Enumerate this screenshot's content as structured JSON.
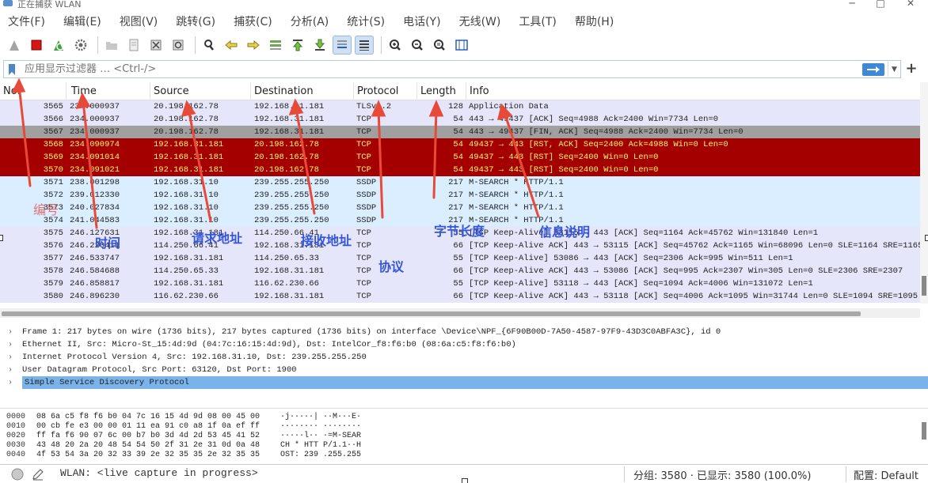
{
  "titlebar": {
    "title": "正在捕获 WLAN",
    "min": "─",
    "max": "□",
    "close": "✕"
  },
  "menu": [
    "文件(F)",
    "编辑(E)",
    "视图(V)",
    "跳转(G)",
    "捕获(C)",
    "分析(A)",
    "统计(S)",
    "电话(Y)",
    "无线(W)",
    "工具(T)",
    "帮助(H)"
  ],
  "filter": {
    "placeholder": "应用显示过滤器 … <Ctrl-/>",
    "apply_icon": "arrow-right-icon",
    "plus": "+"
  },
  "toolbar_icons": [
    "shark-fin-icon",
    "stop-icon",
    "restart-icon",
    "options-gear-icon",
    "open-folder-icon",
    "save-file-icon",
    "close-file-icon",
    "reload-icon",
    "search-icon",
    "back-icon",
    "forward-icon",
    "goto-icon",
    "first-icon",
    "last-icon",
    "autoscroll-icon",
    "colorize-icon",
    "zoom-in-icon",
    "zoom-out-icon",
    "zoom-normal-icon",
    "resize-columns-icon"
  ],
  "columns": [
    "No.",
    "Time",
    "Source",
    "Destination",
    "Protocol",
    "Length",
    "Info"
  ],
  "packets": [
    {
      "no": "3565",
      "time": "234.000937",
      "src": "20.198.162.78",
      "dst": "192.168.31.181",
      "proto": "TLSv1.2",
      "len": "128",
      "info": "Application Data",
      "style": "row-tls"
    },
    {
      "no": "3566",
      "time": "234.000937",
      "src": "20.198.162.78",
      "dst": "192.168.31.181",
      "proto": "TCP",
      "len": "54",
      "info": "443 → 49437 [ACK] Seq=4988 Ack=2400 Win=7734 Len=0",
      "style": "row-tcp"
    },
    {
      "no": "3567",
      "time": "234.000937",
      "src": "20.198.162.78",
      "dst": "192.168.31.181",
      "proto": "TCP",
      "len": "54",
      "info": "443 → 49437 [FIN, ACK] Seq=4988 Ack=2400 Win=7734 Len=0",
      "style": "row-fin"
    },
    {
      "no": "3568",
      "time": "234.090974",
      "src": "192.168.31.181",
      "dst": "20.198.162.78",
      "proto": "TCP",
      "len": "54",
      "info": "49437 → 443 [RST, ACK] Seq=2400 Ack=4988 Win=0 Len=0",
      "style": "row-rst"
    },
    {
      "no": "3569",
      "time": "234.091014",
      "src": "192.168.31.181",
      "dst": "20.198.162.78",
      "proto": "TCP",
      "len": "54",
      "info": "49437 → 443 [RST] Seq=2400 Win=0 Len=0",
      "style": "row-rst"
    },
    {
      "no": "3570",
      "time": "234.091021",
      "src": "192.168.31.181",
      "dst": "20.198.162.78",
      "proto": "TCP",
      "len": "54",
      "info": "49437 → 443 [RST] Seq=2400 Win=0 Len=0",
      "style": "row-rst"
    },
    {
      "no": "3571",
      "time": "238.001298",
      "src": "192.168.31.10",
      "dst": "239.255.255.250",
      "proto": "SSDP",
      "len": "217",
      "info": "M-SEARCH * HTTP/1.1",
      "style": "row-ssdp"
    },
    {
      "no": "3572",
      "time": "239.012330",
      "src": "192.168.31.10",
      "dst": "239.255.255.250",
      "proto": "SSDP",
      "len": "217",
      "info": "M-SEARCH * HTTP/1.1",
      "style": "row-ssdp"
    },
    {
      "no": "3573",
      "time": "240.027834",
      "src": "192.168.31.10",
      "dst": "239.255.255.250",
      "proto": "SSDP",
      "len": "217",
      "info": "M-SEARCH * HTTP/1.1",
      "style": "row-ssdp"
    },
    {
      "no": "3574",
      "time": "241.044583",
      "src": "192.168.31.10",
      "dst": "239.255.255.250",
      "proto": "SSDP",
      "len": "217",
      "info": "M-SEARCH * HTTP/1.1",
      "style": "row-ssdp"
    },
    {
      "no": "3575",
      "time": "246.127631",
      "src": "192.168.31.181",
      "dst": "114.250.66.41",
      "proto": "TCP",
      "len": "55",
      "info": "[TCP Keep-Alive] 53115 → 443 [ACK] Seq=1164 Ack=45762 Win=131840 Len=1",
      "style": "row-ka"
    },
    {
      "no": "3576",
      "time": "246.220411",
      "src": "114.250.66.41",
      "dst": "192.168.31.181",
      "proto": "TCP",
      "len": "66",
      "info": "[TCP Keep-Alive ACK] 443 → 53115 [ACK] Seq=45762 Ack=1165 Win=68096 Len=0 SLE=1164 SRE=1165",
      "style": "row-ka"
    },
    {
      "no": "3577",
      "time": "246.533747",
      "src": "192.168.31.181",
      "dst": "114.250.65.33",
      "proto": "TCP",
      "len": "55",
      "info": "[TCP Keep-Alive] 53086 → 443 [ACK] Seq=2306 Ack=995 Win=511 Len=1",
      "style": "row-ka"
    },
    {
      "no": "3578",
      "time": "246.584688",
      "src": "114.250.65.33",
      "dst": "192.168.31.181",
      "proto": "TCP",
      "len": "66",
      "info": "[TCP Keep-Alive ACK] 443 → 53086 [ACK] Seq=995 Ack=2307 Win=305 Len=0 SLE=2306 SRE=2307",
      "style": "row-ka"
    },
    {
      "no": "3579",
      "time": "246.858817",
      "src": "192.168.31.181",
      "dst": "116.62.230.66",
      "proto": "TCP",
      "len": "55",
      "info": "[TCP Keep-Alive] 53118 → 443 [ACK] Seq=1094 Ack=4006 Win=131072 Len=1",
      "style": "row-ka"
    },
    {
      "no": "3580",
      "time": "246.896230",
      "src": "116.62.230.66",
      "dst": "192.168.31.181",
      "proto": "TCP",
      "len": "66",
      "info": "[TCP Keep-Alive ACK] 443 → 53118 [ACK] Seq=4006 Ack=1095 Win=31744 Len=0 SLE=1094 SRE=1095",
      "style": "row-ka"
    }
  ],
  "details": [
    "Frame 1: 217 bytes on wire (1736 bits), 217 bytes captured (1736 bits) on interface \\Device\\NPF_{6F90B00D-7A50-4587-97F9-43D3C0ABFA3C}, id 0",
    "Ethernet II, Src: Micro-St_15:4d:9d (04:7c:16:15:4d:9d), Dst: IntelCor_f8:f6:b0 (08:6a:c5:f8:f6:b0)",
    "Internet Protocol Version 4, Src: 192.168.31.10, Dst: 239.255.255.250",
    "User Datagram Protocol, Src Port: 63120, Dst Port: 1900",
    "Simple Service Discovery Protocol"
  ],
  "bytes": [
    {
      "off": "0000",
      "hex": "08 6a c5 f8 f6 b0 04 7c  16 15 4d 9d 08 00 45 00",
      "asc": "·j·····|  ··M···E·"
    },
    {
      "off": "0010",
      "hex": "00 cb fe e3 00 00 01 11  ea 91 c0 a8 1f 0a ef ff",
      "asc": "········  ········"
    },
    {
      "off": "0020",
      "hex": "ff fa f6 90 07 6c 00 b7  b0 3d 4d 2d 53 45 41 52",
      "asc": "·····l··  ·=M-SEAR"
    },
    {
      "off": "0030",
      "hex": "43 48 20 2a 20 48 54 54  50 2f 31 2e 31 0d 0a 48",
      "asc": "CH * HTT P/1.1··H"
    },
    {
      "off": "0040",
      "hex": "4f 53 54 3a 20 32 33 39  2e 32 35 35 2e 32 35 35",
      "asc": "OST: 239 .255.255"
    }
  ],
  "status": {
    "live": "WLAN: <live capture in progress>",
    "stats": "分组: 3580 · 已显示: 3580 (100.0%)",
    "profile": "配置: Default"
  },
  "annotations": {
    "number": "编号",
    "time": "时间",
    "source": "请求地址",
    "destination": "接收地址",
    "protocol": "协议",
    "length": "字节长度",
    "info": "信息说明"
  },
  "colors": {
    "rst_bg": "#a40000",
    "rst_fg": "#fbfb6e",
    "fin_bg": "#a0a0a0",
    "ssdp_bg": "#daeeff",
    "tcp_bg": "#e6e6fb",
    "selected": "#7ab2ea",
    "annotation": "#3556d8",
    "arrow": "#e84a3a"
  }
}
